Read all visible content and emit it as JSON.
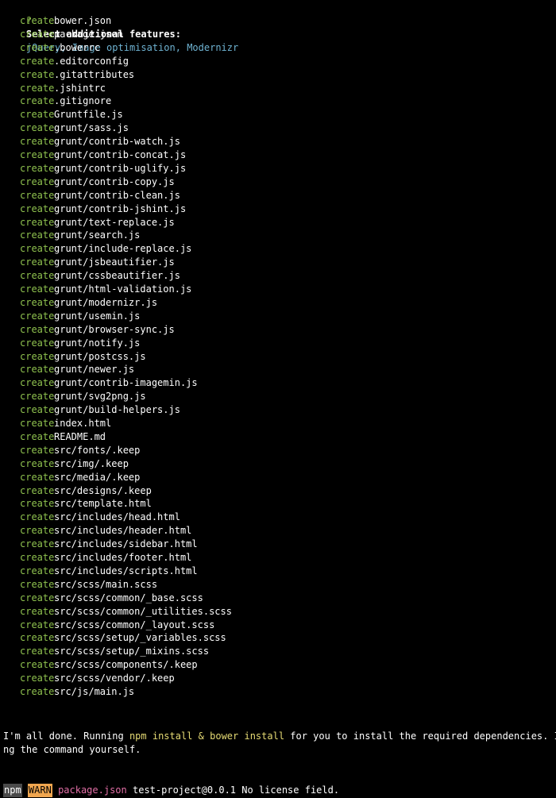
{
  "prompt": {
    "marker": "?",
    "question": "Select additional features:",
    "answer": "jQuery, Image optimisation, Modernizr"
  },
  "create_label": "create",
  "created_files": [
    "bower.json",
    "package.json",
    ".bowerrc",
    ".editorconfig",
    ".gitattributes",
    ".jshintrc",
    ".gitignore",
    "Gruntfile.js",
    "grunt/sass.js",
    "grunt/contrib-watch.js",
    "grunt/contrib-concat.js",
    "grunt/contrib-uglify.js",
    "grunt/contrib-copy.js",
    "grunt/contrib-clean.js",
    "grunt/contrib-jshint.js",
    "grunt/text-replace.js",
    "grunt/search.js",
    "grunt/include-replace.js",
    "grunt/jsbeautifier.js",
    "grunt/cssbeautifier.js",
    "grunt/html-validation.js",
    "grunt/modernizr.js",
    "grunt/usemin.js",
    "grunt/browser-sync.js",
    "grunt/notify.js",
    "grunt/postcss.js",
    "grunt/newer.js",
    "grunt/contrib-imagemin.js",
    "grunt/svg2png.js",
    "grunt/build-helpers.js",
    "index.html",
    "README.md",
    "src/fonts/.keep",
    "src/img/.keep",
    "src/media/.keep",
    "src/designs/.keep",
    "src/template.html",
    "src/includes/head.html",
    "src/includes/header.html",
    "src/includes/sidebar.html",
    "src/includes/footer.html",
    "src/includes/scripts.html",
    "src/scss/main.scss",
    "src/scss/common/_base.scss",
    "src/scss/common/_utilities.scss",
    "src/scss/common/_layout.scss",
    "src/scss/setup/_variables.scss",
    "src/scss/setup/_mixins.scss",
    "src/scss/components/.keep",
    "src/scss/vendor/.keep",
    "src/js/main.js"
  ],
  "done_message": {
    "part1": "I'm all done. Running ",
    "cmd1": "npm install",
    "amp": " & ",
    "cmd2": "bower install",
    "part2": " for you to install the required dependencies. If t",
    "line2": "ng the command yourself."
  },
  "npm_warn": {
    "npm": "npm",
    "warn": "WARN",
    "file": "package.json",
    "message": " test-project@0.0.1 No license field."
  },
  "colors": {
    "background": "#000000",
    "create": "#8fc24f",
    "answer": "#6fb3d2",
    "highlight": "#e6db74",
    "warn_bg": "#f0a64f",
    "package_file": "#e26fa6"
  }
}
